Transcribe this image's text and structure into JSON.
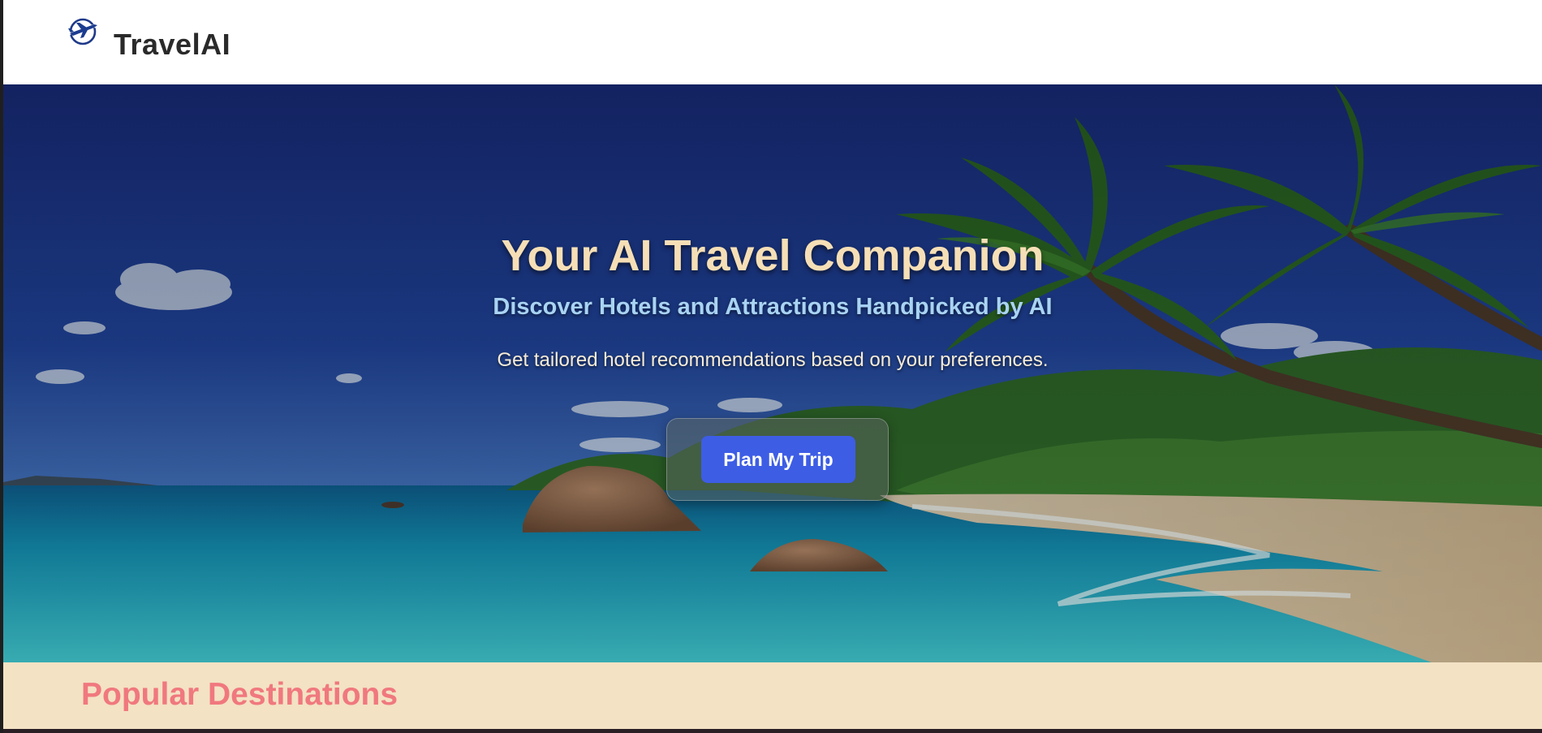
{
  "header": {
    "brand": "TravelAI",
    "logo_icon": "airplane-globe-icon"
  },
  "hero": {
    "title": "Your AI Travel Companion",
    "subtitle": "Discover Hotels and Attractions Handpicked by AI",
    "description": "Get tailored hotel recommendations based on your preferences.",
    "cta_label": "Plan My Trip",
    "background": "tropical-beach-with-palm-trees"
  },
  "popular": {
    "title": "Popular Destinations"
  },
  "colors": {
    "title": "#f6dfb6",
    "subtitle": "#a9d3f2",
    "cta": "#3d5de5",
    "popular_bg": "#f3e2c4",
    "popular_title": "#f0787e"
  }
}
